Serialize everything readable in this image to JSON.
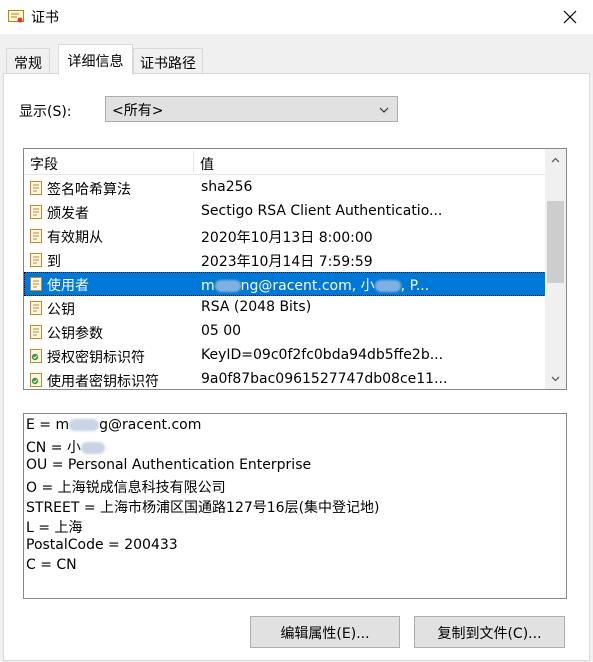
{
  "window": {
    "title": "证书"
  },
  "tabs": [
    {
      "label": "常规"
    },
    {
      "label": "详细信息"
    },
    {
      "label": "证书路径"
    }
  ],
  "show": {
    "label": "显示(S):",
    "value": "<所有>"
  },
  "columns": {
    "field": "字段",
    "value": "值"
  },
  "rows": [
    {
      "field": "签名哈希算法",
      "value": "sha256",
      "icon": "field-doc-icon"
    },
    {
      "field": "颁发者",
      "value": "Sectigo RSA Client Authenticatio...",
      "icon": "field-doc-icon"
    },
    {
      "field": "有效期从",
      "value": "2020年10月13日 8:00:00",
      "icon": "field-doc-icon"
    },
    {
      "field": "到",
      "value": "2023年10月14日 7:59:59",
      "icon": "field-doc-icon"
    },
    {
      "field": "使用者",
      "value_a": "m",
      "value_b": "ng@racent.com, 小",
      "value_c": ", P...",
      "icon": "field-doc-icon",
      "selected": true
    },
    {
      "field": "公钥",
      "value": "RSA (2048 Bits)",
      "icon": "field-doc-icon"
    },
    {
      "field": "公钥参数",
      "value": "05 00",
      "icon": "field-doc-icon"
    },
    {
      "field": "授权密钥标识符",
      "value": "KeyID=09c0f2fc0bda94db5ffe2b...",
      "icon": "extension-icon"
    },
    {
      "field": "使用者密钥标识符",
      "value": "9a0f87bac0961527747db08ce11...",
      "icon": "extension-icon"
    }
  ],
  "detail": {
    "e_prefix": "E = m",
    "e_suffix": "g@racent.com",
    "cn_prefix": "CN = 小",
    "ou": "OU = Personal Authentication Enterprise",
    "o": "O = 上海锐成信息科技有限公司",
    "street": "STREET = 上海市杨浦区国通路127号16层(集中登记地)",
    "l": "L = 上海",
    "postal": "PostalCode = 200433",
    "c": "C = CN"
  },
  "buttons": {
    "edit": "编辑属性(E)...",
    "copy": "复制到文件(C)..."
  },
  "colors": {
    "selection": "#0078d7",
    "panel": "#ffffff",
    "chrome": "#f0f0f0"
  }
}
